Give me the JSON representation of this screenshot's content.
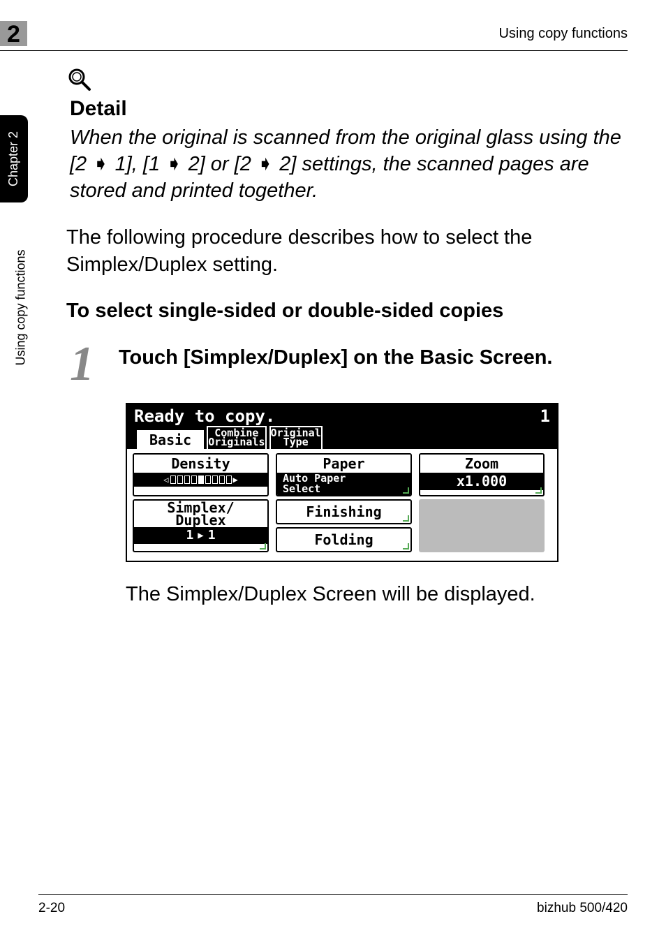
{
  "header": {
    "page_badge": "2",
    "running_title": "Using copy functions"
  },
  "side": {
    "tab": "Chapter 2",
    "vertical_text": "Using copy functions"
  },
  "detail": {
    "heading": "Detail",
    "text_parts": {
      "a": "When the original is scanned from the original glass using the [2",
      "b": "1], [1",
      "c": "2] or [2",
      "d": "2] settings, the scanned pages are stored and printed together."
    }
  },
  "paragraph": "The following procedure describes how to select the Simplex/Duplex setting.",
  "section_heading": "To select single-sided or double-sided copies",
  "step": {
    "num": "1",
    "text": "Touch [Simplex/Duplex] on the Basic Screen."
  },
  "lcd": {
    "status": "Ready to copy.",
    "counter": "1",
    "tabs": {
      "basic": "Basic",
      "combine_l1": "Combine",
      "combine_l2": "Originals",
      "original_l1": "Original",
      "original_l2": "Type"
    },
    "density": {
      "label": "Density"
    },
    "paper": {
      "label": "Paper",
      "sub_l1": "Auto Paper",
      "sub_l2": "Select"
    },
    "zoom": {
      "label": "Zoom",
      "value": "x1.000"
    },
    "simplex": {
      "label_l1": "Simplex/",
      "label_l2": "Duplex",
      "from": "1",
      "to": "1"
    },
    "finishing": "Finishing",
    "folding": "Folding"
  },
  "result_text": "The Simplex/Duplex Screen will be displayed.",
  "footer": {
    "left": "2-20",
    "right": "bizhub 500/420"
  }
}
